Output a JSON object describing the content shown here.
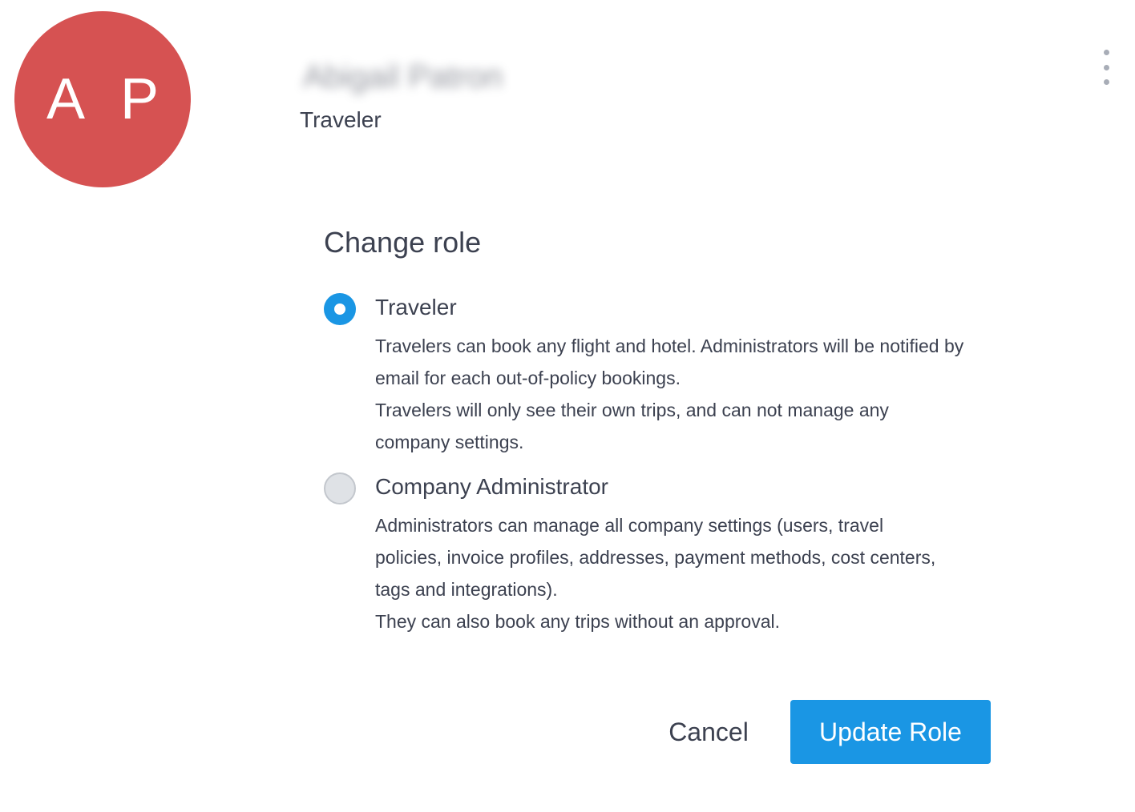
{
  "user": {
    "initials": "A P",
    "name": "Abigail Patron",
    "current_role": "Traveler"
  },
  "icons": {
    "menu": "more-vertical-icon"
  },
  "colors": {
    "avatar": "#d65252",
    "accent": "#1a96e4",
    "text": "#3c4150"
  },
  "change_role": {
    "title": "Change role",
    "selected": "traveler",
    "options": [
      {
        "id": "traveler",
        "label": "Traveler",
        "checked": true,
        "description": [
          "Travelers can book any flight and hotel. Administrators will be notified by email for each out-of-policy bookings.",
          "Travelers will only see their own trips, and can not manage any company settings."
        ]
      },
      {
        "id": "company-administrator",
        "label": "Company Administrator",
        "checked": false,
        "description": [
          "Administrators can manage all company settings (users, travel policies, invoice profiles, addresses, payment methods, cost centers, tags and integrations).",
          "They can also book any trips without an approval."
        ]
      }
    ]
  },
  "actions": {
    "cancel_label": "Cancel",
    "update_label": "Update Role"
  }
}
